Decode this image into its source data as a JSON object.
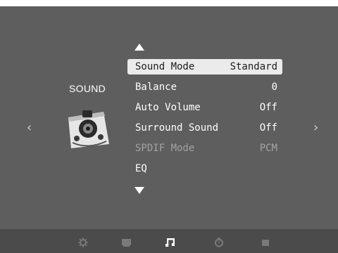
{
  "section_title": "SOUND",
  "icons": {
    "category": "speaker-icon",
    "prev": "chevron-left-icon",
    "next": "chevron-right-icon",
    "scroll_up": "triangle-up-icon",
    "scroll_down": "triangle-down-icon"
  },
  "navigation": {
    "prev_glyph": "‹",
    "next_glyph": "›"
  },
  "menu": {
    "items": [
      {
        "label": "Sound Mode",
        "value": "Standard",
        "state": "selected"
      },
      {
        "label": "Balance",
        "value": "0",
        "state": "normal"
      },
      {
        "label": "Auto Volume",
        "value": "Off",
        "state": "normal"
      },
      {
        "label": "Surround Sound",
        "value": "Off",
        "state": "normal"
      },
      {
        "label": "SPDIF Mode",
        "value": "PCM",
        "state": "disabled"
      },
      {
        "label": "EQ",
        "value": "",
        "state": "normal"
      }
    ]
  },
  "tabs": [
    {
      "icon": "picture-settings-icon",
      "active": false
    },
    {
      "icon": "screen-icon",
      "active": false
    },
    {
      "icon": "music-note-icon",
      "active": true
    },
    {
      "icon": "clock-icon",
      "active": false
    },
    {
      "icon": "lock-icon",
      "active": false
    }
  ],
  "colors": {
    "background": "#5e5e5e",
    "bottom_bar": "#4b4b4b",
    "highlight": "#ebebeb",
    "text": "#ffffff",
    "disabled_text": "#a3a3a3",
    "inactive_tab_icon": "#7a7a7a"
  }
}
